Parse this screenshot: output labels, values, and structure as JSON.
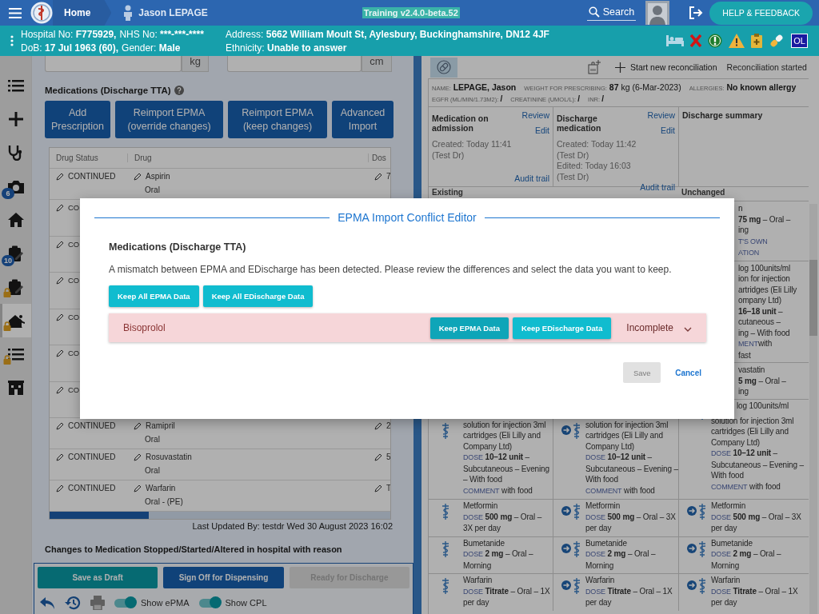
{
  "header": {
    "home": "Home",
    "patient": "Jason LEPAGE",
    "version": "Training v2.4.0-beta.52",
    "search": "Search",
    "help": "HELP & FEEDBACK"
  },
  "banner": {
    "left_lines": [
      [
        {
          "label": "Hospital No:",
          "value": "F775929,"
        },
        {
          "label": "NHS No:",
          "value": "***-***-****"
        }
      ],
      [
        {
          "label": "DoB:",
          "value": "17 Jul 1963 (60),"
        },
        {
          "label": "Gender:",
          "value": "Male"
        }
      ]
    ],
    "right_lines": [
      [
        {
          "label": "Address:",
          "value": "5662 William Moult St, Aylesbury, Buckinghamshire, DN12 4JF"
        }
      ],
      [
        {
          "label": "Ethnicity:",
          "value": "Unable to answer"
        }
      ]
    ],
    "badge": "OL"
  },
  "sidebar": {
    "items": [
      {
        "kind": "list",
        "locked": false,
        "selected": false
      },
      {
        "kind": "plus",
        "locked": false,
        "selected": false
      },
      {
        "kind": "stethoscope",
        "locked": false,
        "selected": false
      },
      {
        "kind": "camera",
        "badge": "6",
        "locked": false,
        "selected": false
      },
      {
        "kind": "home",
        "locked": false,
        "selected": false
      },
      {
        "kind": "clipboard",
        "badge": "10",
        "locked": false,
        "selected": false
      },
      {
        "kind": "clipboard",
        "locked": true,
        "selected": false
      },
      {
        "kind": "runner",
        "locked": true,
        "selected": true
      },
      {
        "kind": "list",
        "locked": true,
        "selected": false
      },
      {
        "kind": "building",
        "locked": false,
        "selected": false
      }
    ]
  },
  "measurements": [
    {
      "unit": "kg"
    },
    {
      "unit": "cm"
    }
  ],
  "medications": {
    "title": "Medications (Discharge TTA)",
    "buttons": [
      "Add Prescription",
      "Reimport EPMA (override changes)",
      "Reimport EPMA (keep changes)",
      "Advanced Import"
    ],
    "columns": [
      "Drug Status",
      "Drug",
      "Dos"
    ],
    "rows": [
      {
        "status": "CONTINUED",
        "drug": "Aspirin",
        "route": "Oral",
        "dose": "7"
      },
      {
        "status": "CO"
      },
      {
        "status": "CO"
      },
      {
        "status": "CO"
      },
      {
        "status": "CO"
      },
      {
        "status": "CO"
      },
      {
        "status": "CO"
      },
      {
        "status": "CONTINUED",
        "drug": "Ramipril",
        "route": "Oral",
        "dose": "2"
      },
      {
        "status": "CONTINUED",
        "drug": "Rosuvastatin",
        "route": "Oral",
        "dose": "5"
      },
      {
        "status": "CONTINUED",
        "drug": "Warfarin",
        "route": "Oral - (PE)",
        "dose": "T"
      }
    ],
    "last_updated": "Last Updated By: testdr Wed 30 August 2023 16:02",
    "changes_heading": "Changes to Medication Stopped/Started/Altered in hospital with reason"
  },
  "footer": {
    "buttons": [
      {
        "label": "Save as Draft",
        "kind": "draft",
        "disabled": false
      },
      {
        "label": "Sign Off for Dispensing",
        "kind": "primary",
        "disabled": false
      },
      {
        "label": "Ready for Discharge",
        "kind": "primary",
        "disabled": true
      }
    ],
    "tools": [
      {
        "kind": "undo",
        "disabled": false
      },
      {
        "kind": "history",
        "disabled": false
      },
      {
        "kind": "print",
        "disabled": true
      }
    ],
    "toggles": [
      {
        "label": "Show ePMA",
        "on": true
      },
      {
        "label": "Show CPL",
        "on": true
      }
    ]
  },
  "reconciliation": {
    "new": "Start new reconciliation",
    "started": "Reconciliation started",
    "info": [
      [
        {
          "label": "NAME:",
          "value": "LEPAGE, Jason",
          "kind": "strong"
        },
        {
          "label": "WEIGHT FOR PRESCRIBING:",
          "value": "**87** kg (6-Mar-2023)",
          "kind": "mixed"
        },
        {
          "label": "ALLERGIES:",
          "value": "No known allergy",
          "kind": "strong"
        }
      ],
      [
        {
          "label": "EGFR (ML/MIN/1.73M2):",
          "value": "/",
          "kind": "strong"
        },
        {
          "label": "CREATININE (UMOL/L):",
          "value": "/",
          "kind": "strong"
        },
        {
          "label": "INR:",
          "value": "/",
          "kind": "strong"
        }
      ]
    ],
    "summaries": [
      {
        "title": "Medication on admission",
        "review": "Review",
        "edit": "Edit",
        "history": [
          "Created: Today 11:41",
          "(Test Dr)"
        ],
        "audit": "Audit trail"
      },
      {
        "title": "Discharge medication",
        "review": "Review",
        "edit": "Edit",
        "history": [
          "Created: Today 11:42",
          "(Test Dr)",
          "Edited: Today 16:03",
          "(Test Dr)"
        ],
        "audit": "Audit trail"
      },
      {
        "title": "Discharge summary"
      }
    ],
    "existing_header": "Existing",
    "unchanged_header": "Unchanged",
    "unchanged_fragments": [
      [
        {
          "text": "n"
        },
        {
          "text": "**75 mg** – Oral –"
        },
        {
          "text": "ing"
        },
        {
          "label": "T'S OWN"
        },
        {
          "label": "ATION"
        }
      ],
      [
        {
          "text": "log 100units/ml"
        },
        {
          "text": "ion for injection"
        },
        {
          "text": "artridges (Eli Lilly"
        },
        {
          "text": "ompany Ltd)"
        },
        {
          "text": "**16–18 unit** –"
        },
        {
          "text": "cutaneous –"
        },
        {
          "text": "ing – With food"
        },
        {
          "label": "MENT",
          "text": "with"
        },
        {
          "text": "fast"
        }
      ],
      [
        {
          "text": "vastatin"
        },
        {
          "text": "**5 mg** – Oral –"
        },
        {
          "text": "ing"
        }
      ]
    ],
    "rows": [
      {
        "cells": [
          {
            "kind": "existing",
            "name": "solution for injection 3ml cartridges (Eli Lilly and Company Ltd)",
            "dose_label": "DOSE",
            "dose": "**10–12 unit** – Subcutaneous – Evening – With food",
            "note_label": "COMMENT",
            "note": "with food"
          },
          {
            "kind": "carried",
            "name": "solution for injection 3ml cartridges (Eli Lilly and Company Ltd)",
            "dose_label": "DOSE",
            "dose": "**10–12 unit** – Subcutaneous – Evening – With food",
            "note_label": "COMMENT",
            "note": "with food"
          },
          {
            "kind": "carried",
            "cut_line": "log 100units/ml",
            "name": "solution for injection 3ml cartridges (Eli Lilly and Company Ltd)",
            "dose_label": "DOSE",
            "dose": "**10–12 unit** – Subcutaneous – Evening – With food",
            "note_label": "COMMENT",
            "note": "with food"
          }
        ]
      },
      {
        "cells": [
          {
            "kind": "existing",
            "name": "Metformin",
            "dose_label": "DOSE",
            "dose": "**500 mg** – Oral – 3X per day"
          },
          {
            "kind": "carried",
            "name": "Metformin",
            "dose_label": "DOSE",
            "dose": "**500 mg** – Oral – 3X per day"
          },
          {
            "kind": "carried",
            "name": "Metformin",
            "dose_label": "DOSE",
            "dose": "**500 mg** – Oral – 3X per day"
          }
        ]
      },
      {
        "cells": [
          {
            "kind": "existing",
            "name": "Bumetanide",
            "dose_label": "DOSE",
            "dose": "**2 mg** – Oral – Morning"
          },
          {
            "kind": "carried",
            "name": "Bumetanide",
            "dose_label": "DOSE",
            "dose": "**2 mg** – Oral – Morning"
          },
          {
            "kind": "carried",
            "name": "Bumetanide",
            "dose_label": "DOSE",
            "dose": "**2 mg** – Oral – Morning"
          }
        ]
      },
      {
        "cells": [
          {
            "kind": "existing",
            "name": "Warfarin",
            "dose_label": "DOSE",
            "dose": "**Titrate** – Oral – 1X per day"
          },
          {
            "kind": "carried",
            "name": "Warfarin",
            "dose_label": "DOSE",
            "dose": "**Titrate** – Oral – 1X per day"
          },
          {
            "kind": "carried",
            "name": "Warfarin",
            "dose_label": "DOSE",
            "dose": "**Titrate** – Oral – 1X per day"
          }
        ]
      }
    ]
  },
  "conflict_editor": {
    "title": "EPMA Import Conflict Editor",
    "section": "Medications (Discharge TTA)",
    "message": "A mismatch between EPMA and EDischarge has been detected. Please review the differences and select the data you want to keep.",
    "bulk_buttons": [
      "Keep All EPMA Data",
      "Keep All EDischarge Data"
    ],
    "conflicts": [
      {
        "drug": "Bisoprolol",
        "keep_epma": "Keep EPMA Data",
        "keep_edischarge": "Keep EDischarge Data",
        "status": "Incomplete",
        "expanded": false
      }
    ],
    "save": {
      "label": "Save",
      "disabled": true
    },
    "cancel": "Cancel"
  }
}
